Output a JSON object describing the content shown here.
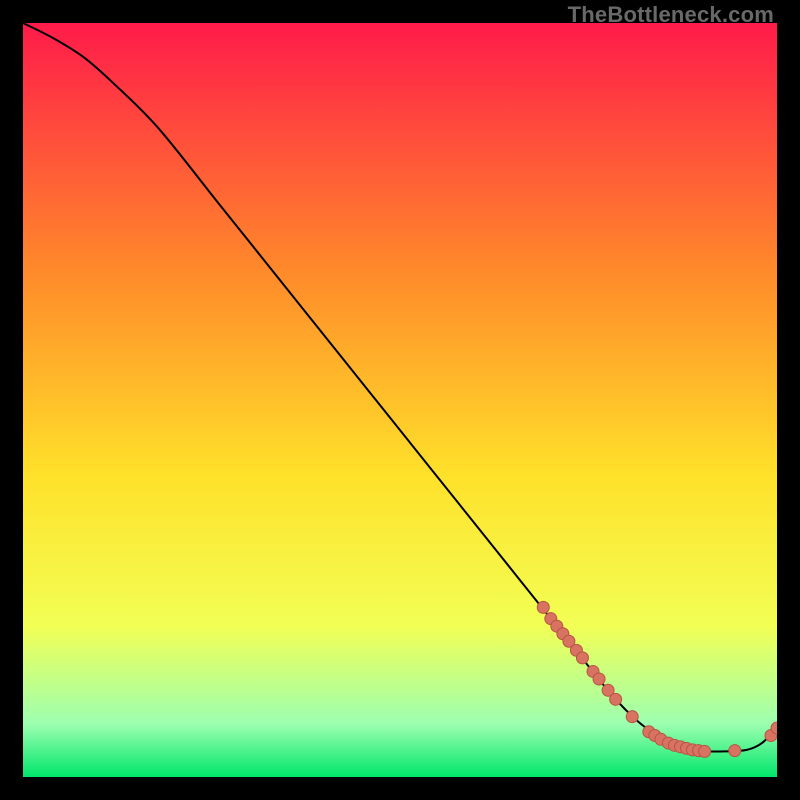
{
  "watermark": "TheBottleneck.com",
  "colors": {
    "gradient_top": "#ff1b4a",
    "gradient_mid1": "#ff8a2a",
    "gradient_mid2": "#ffe12a",
    "gradient_mid3": "#f2ff55",
    "gradient_bottom_band": "#9cffb0",
    "gradient_bottom": "#00e66a",
    "curve": "#000000",
    "marker_fill": "#d87362",
    "marker_stroke": "#b75443"
  },
  "chart_data": {
    "type": "line",
    "title": "",
    "xlabel": "",
    "ylabel": "",
    "xlim": [
      0,
      100
    ],
    "ylim": [
      0,
      100
    ],
    "series": [
      {
        "name": "bottleneck-curve",
        "x": [
          0,
          4,
          8,
          12,
          18,
          26,
          34,
          42,
          50,
          58,
          66,
          72,
          78,
          82,
          86,
          90,
          93,
          96,
          98,
          100
        ],
        "y": [
          100,
          98,
          95.5,
          92,
          86,
          76,
          66,
          56,
          46,
          36,
          26,
          18.5,
          11,
          7,
          4.5,
          3.5,
          3.4,
          3.6,
          4.5,
          6.5
        ]
      }
    ],
    "markers": [
      {
        "x": 69.0,
        "y": 22.5
      },
      {
        "x": 70.0,
        "y": 21.0
      },
      {
        "x": 70.8,
        "y": 20.0
      },
      {
        "x": 71.6,
        "y": 19.0
      },
      {
        "x": 72.4,
        "y": 18.0
      },
      {
        "x": 73.4,
        "y": 16.8
      },
      {
        "x": 74.2,
        "y": 15.8
      },
      {
        "x": 75.6,
        "y": 14.0
      },
      {
        "x": 76.4,
        "y": 13.0
      },
      {
        "x": 77.6,
        "y": 11.5
      },
      {
        "x": 78.6,
        "y": 10.3
      },
      {
        "x": 80.8,
        "y": 8.0
      },
      {
        "x": 83.0,
        "y": 6.0
      },
      {
        "x": 83.8,
        "y": 5.5
      },
      {
        "x": 84.6,
        "y": 5.0
      },
      {
        "x": 85.6,
        "y": 4.5
      },
      {
        "x": 86.4,
        "y": 4.2
      },
      {
        "x": 87.2,
        "y": 4.0
      },
      {
        "x": 88.0,
        "y": 3.8
      },
      {
        "x": 88.8,
        "y": 3.6
      },
      {
        "x": 89.6,
        "y": 3.5
      },
      {
        "x": 90.4,
        "y": 3.4
      },
      {
        "x": 94.4,
        "y": 3.5
      },
      {
        "x": 99.2,
        "y": 5.5
      },
      {
        "x": 100.0,
        "y": 6.5
      }
    ]
  }
}
